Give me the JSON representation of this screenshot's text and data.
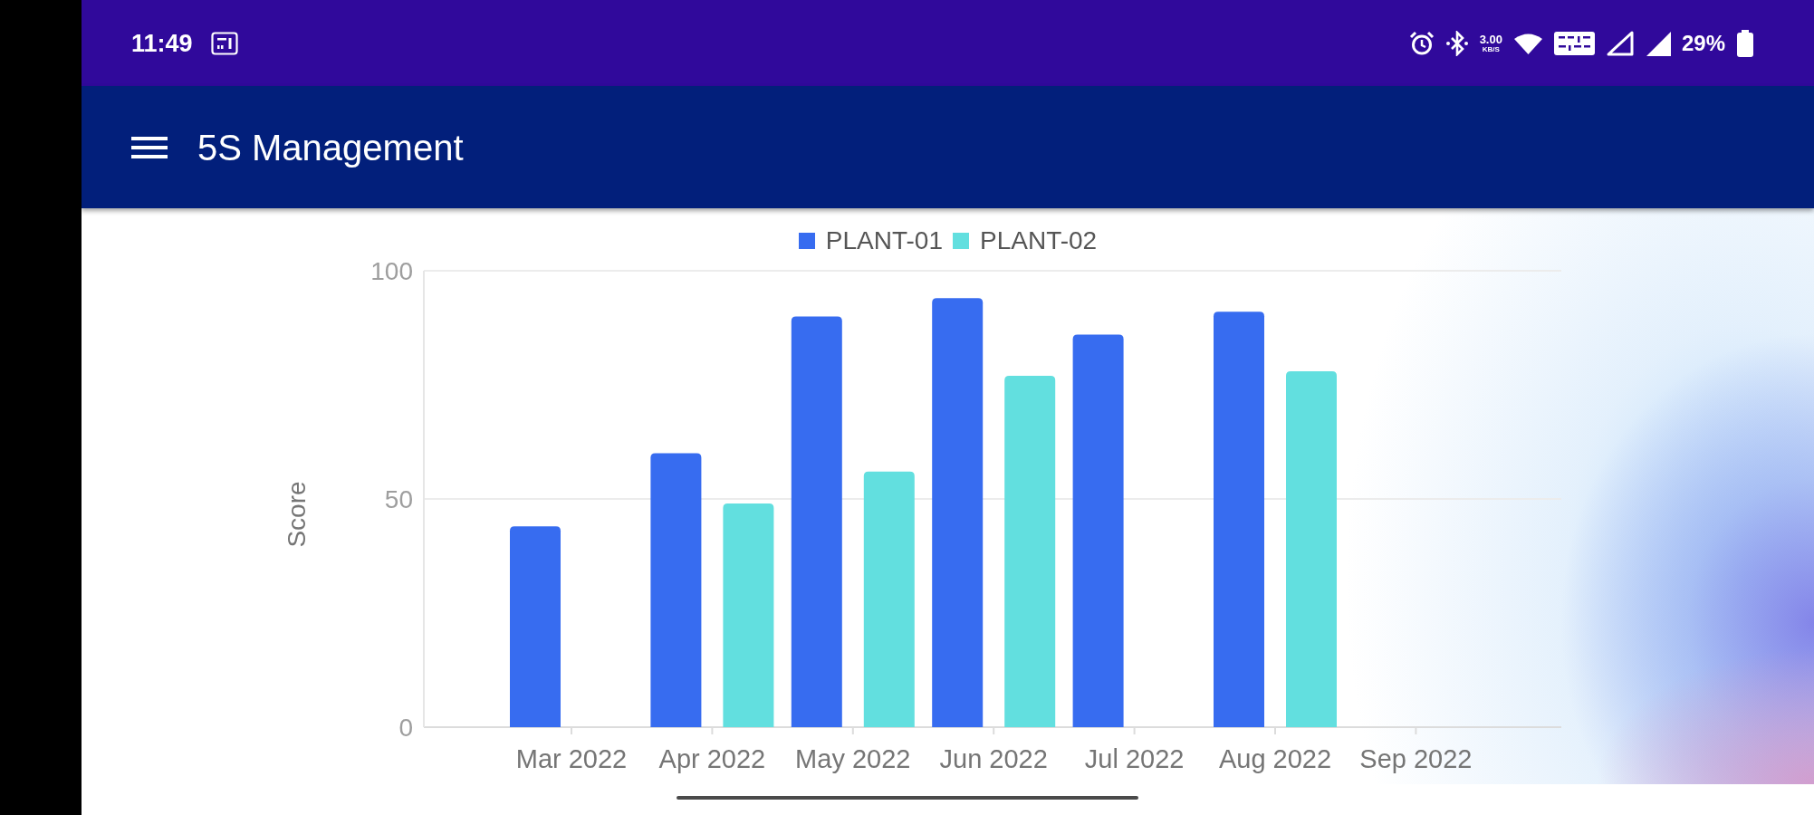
{
  "status_bar": {
    "time": "11:49",
    "network_speed": {
      "value": "3.00",
      "unit": "KB/S"
    },
    "battery": "29%"
  },
  "app_bar": {
    "title": "5S Management"
  },
  "chart": {
    "chart_data": {
      "type": "bar",
      "ylabel": "Score",
      "categories": [
        "Mar 2022",
        "Apr 2022",
        "May 2022",
        "Jun 2022",
        "Jul 2022",
        "Aug 2022",
        "Sep 2022"
      ],
      "series": [
        {
          "name": "PLANT-01",
          "color": "#376cf0",
          "values": [
            44,
            60,
            90,
            94,
            86,
            91,
            null
          ]
        },
        {
          "name": "PLANT-02",
          "color": "#62dfdf",
          "values": [
            null,
            49,
            56,
            77,
            null,
            78,
            null
          ]
        }
      ],
      "ylim": [
        0,
        100
      ],
      "yticks": [
        0,
        50,
        100
      ]
    }
  }
}
